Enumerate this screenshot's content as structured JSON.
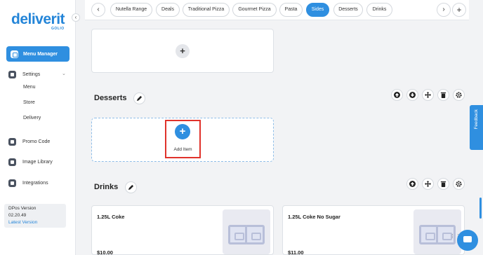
{
  "brand": {
    "name": "deliverit",
    "sub": "GOLIO"
  },
  "sidebar": {
    "collapse_icon": "chevron-left-icon",
    "active_item": "Menu Manager",
    "settings_label": "Settings",
    "settings_subitems": [
      "Menu",
      "Store",
      "Delivery"
    ],
    "promo_label": "Promo Code",
    "image_library_label": "Image Library",
    "integrations_label": "Integrations",
    "version_label": "DPos Version",
    "version_number": "02.20.49",
    "latest_version_link": "Latest Version"
  },
  "category_tabs": [
    "Nutella Range",
    "Deals",
    "Traditional Pizza",
    "Gourmet Pizza",
    "Pasta",
    "Sides",
    "Desserts",
    "Drinks"
  ],
  "active_tab": "Sides",
  "sections": {
    "desserts": {
      "title": "Desserts",
      "add_item_label": "Add Item"
    },
    "drinks": {
      "title": "Drinks",
      "items": [
        {
          "name": "1.25L Coke",
          "price": "$10.00"
        },
        {
          "name": "1.25L Coke No Sugar",
          "price": "$11.00"
        }
      ]
    }
  },
  "feedback_label": "Feedback",
  "colors": {
    "accent": "#2f8fe0",
    "highlight": "#e0322b",
    "background": "#f2f3f5"
  }
}
